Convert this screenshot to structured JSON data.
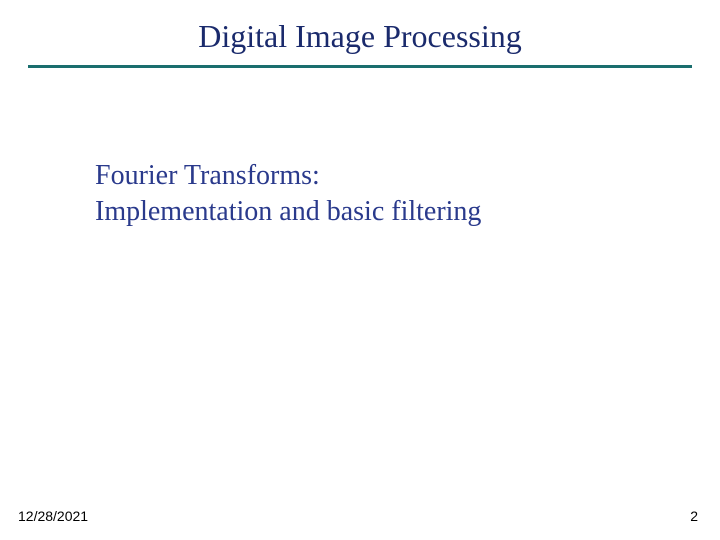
{
  "title": "Digital Image Processing",
  "subtitle_line1": "Fourier Transforms:",
  "subtitle_line2": "Implementation and basic filtering",
  "footer": {
    "date": "12/28/2021",
    "page": "2"
  }
}
